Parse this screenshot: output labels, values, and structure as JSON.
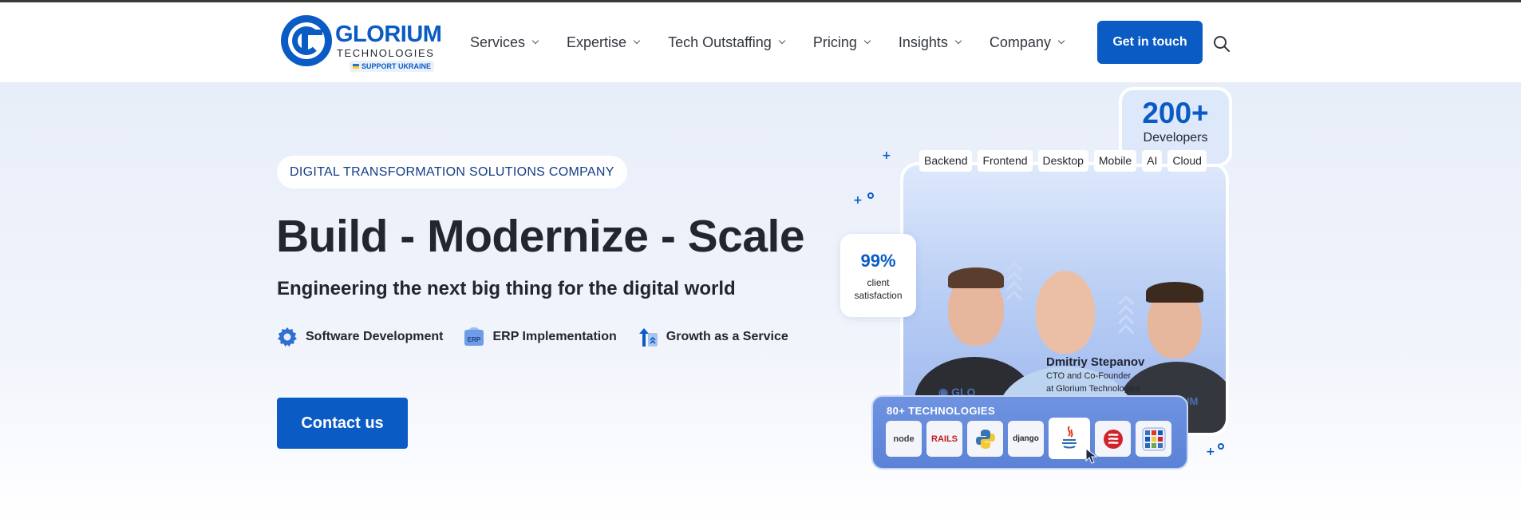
{
  "logo": {
    "name": "GLORIUM",
    "subtitle": "TECHNOLOGIES",
    "support": "SUPPORT UKRAINE"
  },
  "nav": {
    "items": [
      {
        "label": "Services"
      },
      {
        "label": "Expertise"
      },
      {
        "label": "Tech Outstaffing"
      },
      {
        "label": "Pricing"
      },
      {
        "label": "Insights"
      },
      {
        "label": "Company"
      }
    ],
    "cta": "Get in touch",
    "search_icon": "search-icon"
  },
  "hero": {
    "pill": "DIGITAL TRANSFORMATION SOLUTIONS COMPANY",
    "headline": "Build - Modernize - Scale",
    "subheadline": "Engineering the next big thing for the digital world",
    "services": [
      {
        "label": "Software Development",
        "icon": "gear-icon"
      },
      {
        "label": "ERP Implementation",
        "icon": "erp-icon"
      },
      {
        "label": "Growth as a Service",
        "icon": "growth-arrow-icon"
      }
    ],
    "contact": "Contact us"
  },
  "card": {
    "developers_count": "200+",
    "developers_label": "Developers",
    "tags": [
      "Backend",
      "Frontend",
      "Desktop",
      "Mobile",
      "AI",
      "Cloud"
    ],
    "satisfaction_value": "99%",
    "satisfaction_label_1": "client",
    "satisfaction_label_2": "satisfaction",
    "person_name": "Dmitriy Stepanov",
    "person_role_1": "CTO and Co-Founder",
    "person_role_2": "at Glorium Technologies",
    "technologies_label": "80+ TECHNOLOGIES",
    "technologies": [
      {
        "label": "node",
        "icon": "nodejs-icon"
      },
      {
        "label": "RAILS",
        "icon": "rails-icon"
      },
      {
        "label": "",
        "icon": "python-icon"
      },
      {
        "label": "django",
        "icon": "django-icon"
      },
      {
        "label": "",
        "icon": "java-icon"
      },
      {
        "label": "",
        "icon": "scala-icon"
      },
      {
        "label": "",
        "icon": "more-technologies-icon"
      }
    ]
  },
  "colors": {
    "brand": "#0a5bc4",
    "text": "#23262e",
    "hero_bg": "#e8eef9"
  }
}
